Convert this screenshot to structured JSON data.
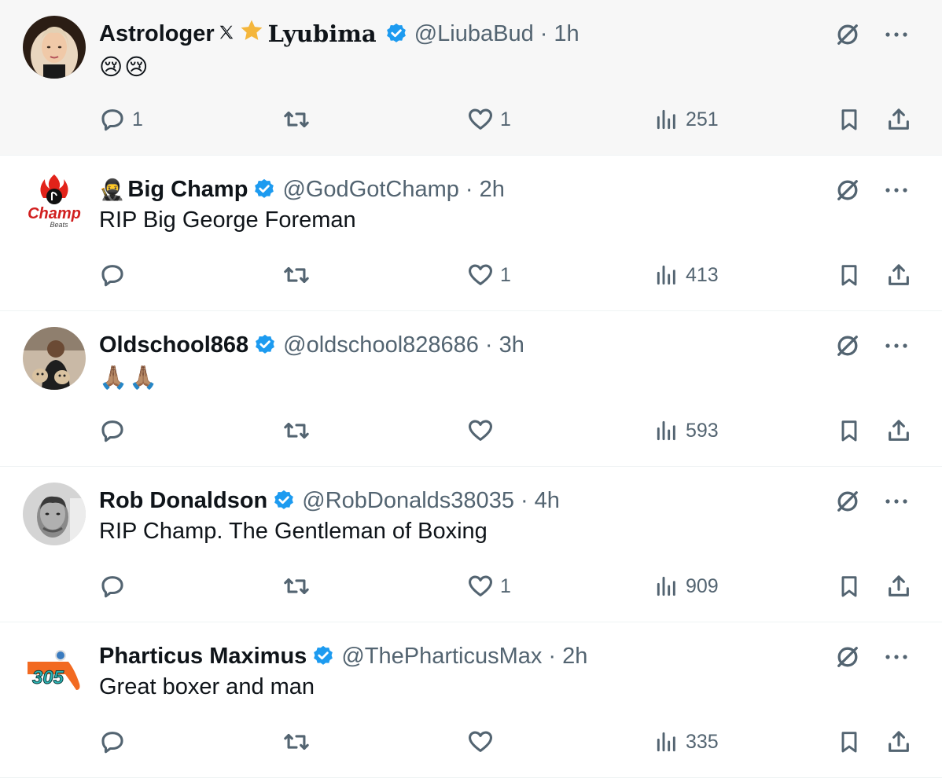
{
  "tweets": [
    {
      "name": "Astrologer",
      "name_extra": "Lyubima",
      "handle": "@LiubaBud",
      "dot": "·",
      "time": "1h",
      "text": "",
      "emoji": [
        "😢",
        "😢"
      ],
      "replies": "1",
      "retweets": "",
      "likes": "1",
      "views": "251",
      "hovered": true
    },
    {
      "name": "Big Champ",
      "name_prefix_emoji": "🥷",
      "handle": "@GodGotChamp",
      "dot": "·",
      "time": "2h",
      "text": "RIP Big George Foreman",
      "replies": "",
      "retweets": "",
      "likes": "1",
      "views": "413",
      "avatar_text": "Champ"
    },
    {
      "name": "Oldschool868",
      "handle": "@oldschool828686",
      "dot": "·",
      "time": "3h",
      "text": "",
      "emoji": [
        "🙏🏽",
        "🙏🏽"
      ],
      "replies": "",
      "retweets": "",
      "likes": "",
      "views": "593"
    },
    {
      "name": "Rob Donaldson",
      "handle": "@RobDonalds38035",
      "dot": "·",
      "time": "4h",
      "text": "RIP Champ. The Gentleman of Boxing",
      "replies": "",
      "retweets": "",
      "likes": "1",
      "views": "909"
    },
    {
      "name": "Pharticus Maximus",
      "handle": "@ThePharticusMax",
      "dot": "·",
      "time": "2h",
      "text": "Great boxer and man",
      "replies": "",
      "retweets": "",
      "likes": "",
      "views": "335",
      "avatar_text": "305"
    }
  ],
  "icons": {
    "verified_color": "#1d9bf0",
    "star_color": "#f4b63c",
    "icon_color": "#536471"
  }
}
